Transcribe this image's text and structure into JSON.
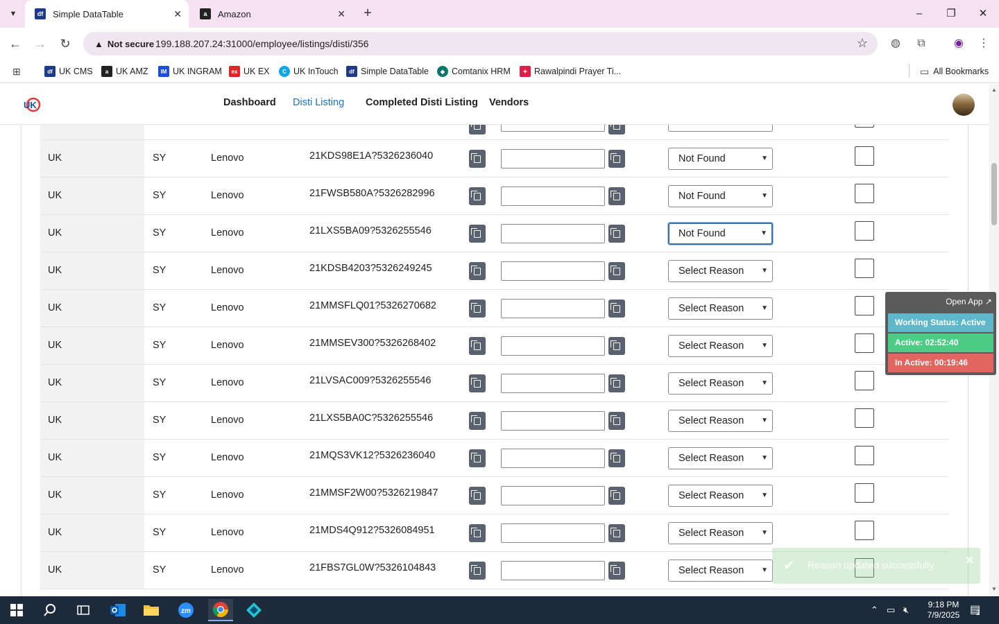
{
  "browser": {
    "tabs": [
      {
        "label": "Simple DataTable",
        "active": true
      },
      {
        "label": "Amazon",
        "active": false
      }
    ],
    "address": {
      "security_label": "Not secure",
      "url": "199.188.207.24:31000/employee/listings/disti/356"
    },
    "bookmarks": [
      {
        "label": "UK CMS",
        "icon": "uk-cms-icon",
        "color": "#1e3a8a",
        "glyph": "df"
      },
      {
        "label": "UK AMZ",
        "icon": "amazon-icon",
        "color": "#222222",
        "glyph": "a"
      },
      {
        "label": "UK INGRAM",
        "icon": "ingram-icon",
        "color": "#1d4ed8",
        "glyph": "IM"
      },
      {
        "label": "UK EX",
        "icon": "ex-icon",
        "color": "#dc2626",
        "glyph": "ex"
      },
      {
        "label": "UK InTouch",
        "icon": "intouch-icon",
        "color": "#0ea5e9",
        "glyph": "C"
      },
      {
        "label": "Simple DataTable",
        "icon": "datatable-icon",
        "color": "#1e3a8a",
        "glyph": "df"
      },
      {
        "label": "Comtanix HRM",
        "icon": "hrm-icon",
        "color": "#0f766e",
        "glyph": "◆"
      },
      {
        "label": "Rawalpindi Prayer Ti...",
        "icon": "prayer-icon",
        "color": "#e11d48",
        "glyph": "✦"
      }
    ],
    "all_bookmarks_label": "All Bookmarks"
  },
  "app": {
    "nav": [
      {
        "label": "Dashboard",
        "active": false
      },
      {
        "label": "Disti Listing",
        "active": true
      },
      {
        "label": "Completed Disti Listing",
        "active": false
      },
      {
        "label": "Vendors",
        "active": false
      }
    ]
  },
  "table": {
    "rows": [
      {
        "region": "UK",
        "code": "SY",
        "brand": "Lenovo",
        "sku": "21KDS98E1A?5326236040",
        "input": "",
        "reason": "Not Found",
        "checked": false
      },
      {
        "region": "UK",
        "code": "SY",
        "brand": "Lenovo",
        "sku": "21FWSB580A?5326282996",
        "input": "",
        "reason": "Not Found",
        "checked": false
      },
      {
        "region": "UK",
        "code": "SY",
        "brand": "Lenovo",
        "sku": "21LXS5BA09?5326255546",
        "input": "",
        "reason": "Not Found",
        "checked": false,
        "focused": true
      },
      {
        "region": "UK",
        "code": "SY",
        "brand": "Lenovo",
        "sku": "21KDSB4203?5326249245",
        "input": "",
        "reason": "Select Reason",
        "checked": false
      },
      {
        "region": "UK",
        "code": "SY",
        "brand": "Lenovo",
        "sku": "21MMSFLQ01?5326270682",
        "input": "",
        "reason": "Select Reason",
        "checked": false
      },
      {
        "region": "UK",
        "code": "SY",
        "brand": "Lenovo",
        "sku": "21MMSEV300?5326268402",
        "input": "",
        "reason": "Select Reason",
        "checked": false
      },
      {
        "region": "UK",
        "code": "SY",
        "brand": "Lenovo",
        "sku": "21LVSAC009?5326255546",
        "input": "",
        "reason": "Select Reason",
        "checked": false
      },
      {
        "region": "UK",
        "code": "SY",
        "brand": "Lenovo",
        "sku": "21LXS5BA0C?5326255546",
        "input": "",
        "reason": "Select Reason",
        "checked": false
      },
      {
        "region": "UK",
        "code": "SY",
        "brand": "Lenovo",
        "sku": "21MQS3VK12?5326236040",
        "input": "",
        "reason": "Select Reason",
        "checked": false
      },
      {
        "region": "UK",
        "code": "SY",
        "brand": "Lenovo",
        "sku": "21MMSF2W00?5326219847",
        "input": "",
        "reason": "Select Reason",
        "checked": false
      },
      {
        "region": "UK",
        "code": "SY",
        "brand": "Lenovo",
        "sku": "21MDS4Q912?5326084951",
        "input": "",
        "reason": "Select Reason",
        "checked": false
      },
      {
        "region": "UK",
        "code": "SY",
        "brand": "Lenovo",
        "sku": "21FBS7GL0W?5326104843",
        "input": "",
        "reason": "Select Reason",
        "checked": false
      }
    ]
  },
  "widget": {
    "open_app_label": "Open App ↗",
    "working_status": "Working Status: Active",
    "active_time": "Active: 02:52:40",
    "inactive_time": "In Active: 00:19:46",
    "colors": {
      "status": "#5fb8c9",
      "active": "#4ccc84",
      "inactive": "#e26560"
    }
  },
  "toast": {
    "message": "Reason updated successfully."
  },
  "taskbar": {
    "time": "9:18 PM",
    "date": "7/9/2025",
    "notifications": "2"
  }
}
